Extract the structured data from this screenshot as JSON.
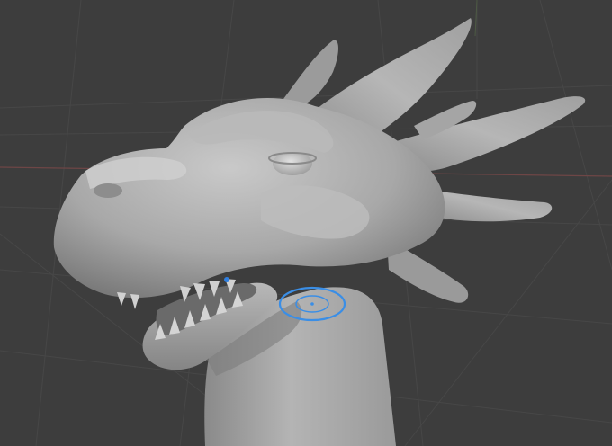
{
  "viewport": {
    "background_color": "#3d3d3d",
    "grid_color": "#454545",
    "x_axis_color": "#7a4848",
    "y_axis_color": "#4a5a3e",
    "show_grid": true,
    "show_floor_axes": true
  },
  "mesh": {
    "subject": "dragon-head-sculpt",
    "shading": "matcap-clay",
    "base_color": "#a9a9a9",
    "highlight_color": "#d8d8d8",
    "shadow_color": "#6e6e6e"
  },
  "brush_cursor": {
    "color": "#3a8ee6",
    "visible": true
  },
  "origin_marker": {
    "color": "#2f7fe0",
    "visible": true
  }
}
